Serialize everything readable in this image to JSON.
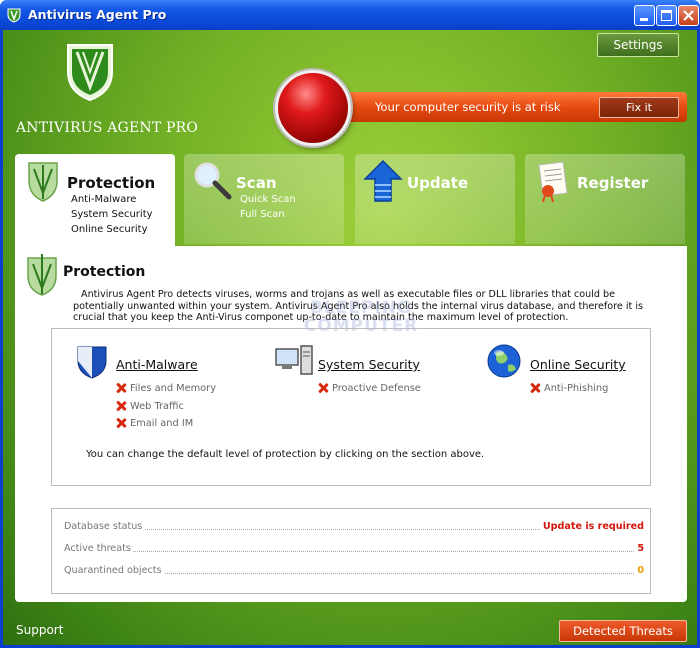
{
  "window": {
    "title": "Antivirus Agent Pro"
  },
  "brand": {
    "name": "ANTIVIRUS AGENT PRO"
  },
  "header": {
    "settings_label": "Settings",
    "alert_text": "Your computer security is at risk",
    "fix_label": "Fix it"
  },
  "tabs": [
    {
      "title": "Protection",
      "subs": [
        "Anti-Malware",
        "System Security",
        "Online Security"
      ],
      "icon": "shield-icon"
    },
    {
      "title": "Scan",
      "subs": [
        "Quick Scan",
        "Full Scan"
      ],
      "icon": "magnifier-icon"
    },
    {
      "title": "Update",
      "subs": [],
      "icon": "up-arrow-icon"
    },
    {
      "title": "Register",
      "subs": [],
      "icon": "certificate-icon"
    }
  ],
  "section": {
    "title": "Protection",
    "description": "Antivirus Agent Pro detects viruses, worms and trojans as well as executable files or DLL libraries that could be potentially unwanted within your system. Antivirus Agent Pro also holds the internal virus database, and therefore it is crucial that you keep the Anti-Virus componet up-to-date to maintain the maximum level of protection.",
    "watermark": "BLEEPING COMPUTER"
  },
  "features": [
    {
      "title": "Anti-Malware",
      "items": [
        "Files and Memory",
        "Web Traffic",
        "Email and IM"
      ],
      "icon": "shield-blue-icon"
    },
    {
      "title": "System Security",
      "items": [
        "Proactive Defense"
      ],
      "icon": "computer-icon"
    },
    {
      "title": "Online Security",
      "items": [
        "Anti-Phishing"
      ],
      "icon": "globe-icon"
    }
  ],
  "hint": "You can change the default level of protection by clicking on the section above.",
  "status": [
    {
      "label": "Database status",
      "value": "Update is required",
      "color": "#d4140b"
    },
    {
      "label": "Active threats",
      "value": "5",
      "color": "#d4140b"
    },
    {
      "label": "Quarantined objects",
      "value": "0",
      "color": "#e8a000"
    }
  ],
  "footer": {
    "support_label": "Support",
    "detected_label": "Detected Threats"
  }
}
